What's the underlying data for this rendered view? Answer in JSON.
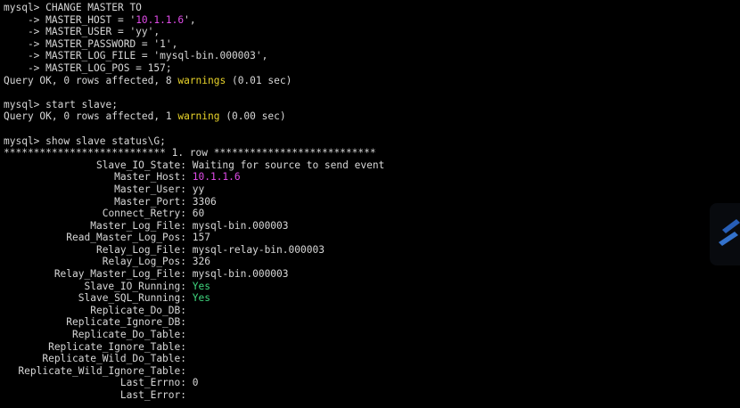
{
  "terminal": {
    "colors": {
      "background": "#000000",
      "text": "#d7d7d7",
      "string_value": "#e04be8",
      "warning": "#e8d32a",
      "yes": "#3fd67e"
    },
    "cmd1": {
      "prompt": "mysql> CHANGE MASTER TO",
      "c1_pre": "    -> MASTER_HOST = '",
      "c1_val": "10.1.1.6",
      "c1_post": "',",
      "c2": "    -> MASTER_USER = 'yy',",
      "c3": "    -> MASTER_PASSWORD = '1',",
      "c4": "    -> MASTER_LOG_FILE = 'mysql-bin.000003',",
      "c5": "    -> MASTER_LOG_POS = 157;",
      "result_pre": "Query OK, 0 rows affected, 8 ",
      "result_warn": "warnings",
      "result_post": " (0.01 sec)"
    },
    "cmd2": {
      "prompt": "mysql> start slave;",
      "result_pre": "Query OK, 0 rows affected, 1 ",
      "result_warn": "warning",
      "result_post": " (0.00 sec)"
    },
    "cmd3": {
      "prompt": "mysql> show slave status\\G;",
      "row_header": "*************************** 1. row ***************************"
    },
    "status": [
      {
        "key": "Slave_IO_State:",
        "value": "Waiting for source to send event",
        "color": "normal"
      },
      {
        "key": "Master_Host:",
        "value": "10.1.1.6",
        "color": "mag"
      },
      {
        "key": "Master_User:",
        "value": "yy",
        "color": "normal"
      },
      {
        "key": "Master_Port:",
        "value": "3306",
        "color": "normal"
      },
      {
        "key": "Connect_Retry:",
        "value": "60",
        "color": "normal"
      },
      {
        "key": "Master_Log_File:",
        "value": "mysql-bin.000003",
        "color": "normal"
      },
      {
        "key": "Read_Master_Log_Pos:",
        "value": "157",
        "color": "normal"
      },
      {
        "key": "Relay_Log_File:",
        "value": "mysql-relay-bin.000003",
        "color": "normal"
      },
      {
        "key": "Relay_Log_Pos:",
        "value": "326",
        "color": "normal"
      },
      {
        "key": "Relay_Master_Log_File:",
        "value": "mysql-bin.000003",
        "color": "normal"
      },
      {
        "key": "Slave_IO_Running:",
        "value": "Yes",
        "color": "grn"
      },
      {
        "key": "Slave_SQL_Running:",
        "value": "Yes",
        "color": "grn"
      },
      {
        "key": "Replicate_Do_DB:",
        "value": "",
        "color": "normal"
      },
      {
        "key": "Replicate_Ignore_DB:",
        "value": "",
        "color": "normal"
      },
      {
        "key": "Replicate_Do_Table:",
        "value": "",
        "color": "normal"
      },
      {
        "key": "Replicate_Ignore_Table:",
        "value": "",
        "color": "normal"
      },
      {
        "key": "Replicate_Wild_Do_Table:",
        "value": "",
        "color": "normal"
      },
      {
        "key": "Replicate_Wild_Ignore_Table:",
        "value": "",
        "color": "normal"
      },
      {
        "key": "Last_Errno:",
        "value": "0",
        "color": "normal"
      },
      {
        "key": "Last_Error:",
        "value": "",
        "color": "normal"
      }
    ],
    "overlay_icon": "floating-app-icon"
  }
}
